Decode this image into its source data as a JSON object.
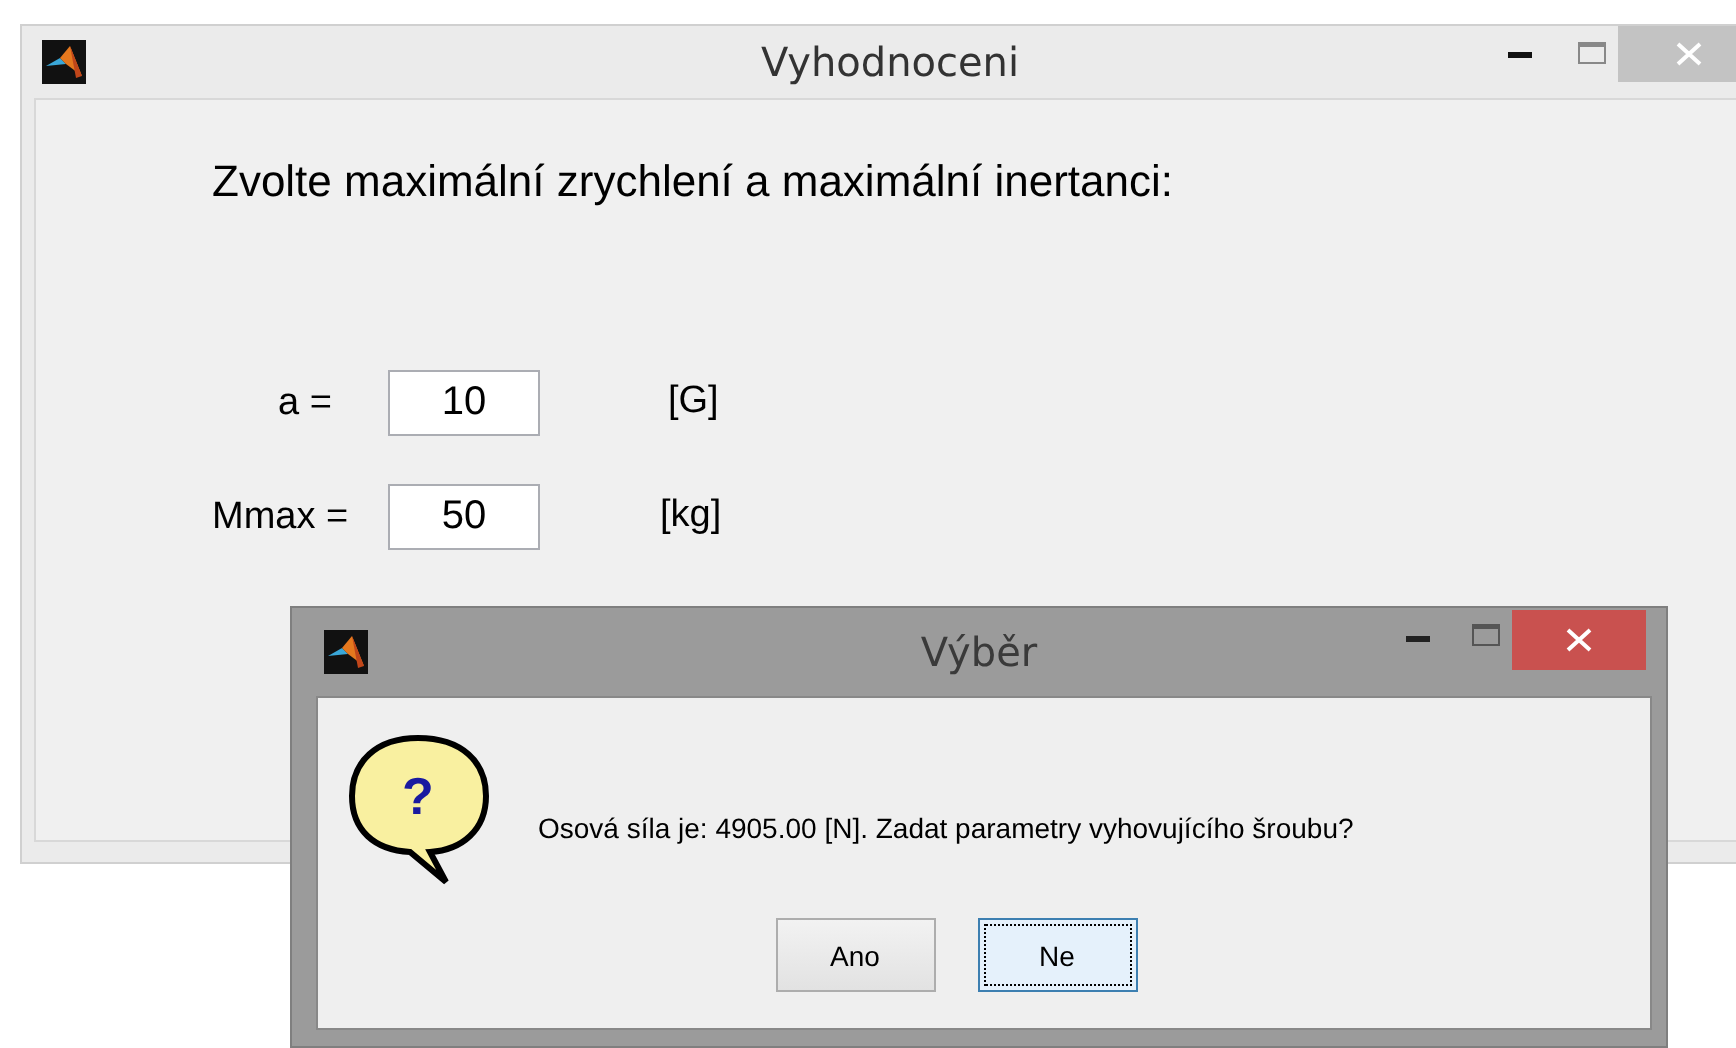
{
  "window": {
    "title": "Vyhodnoceni"
  },
  "prompt": "Zvolte maximální zrychlení a maximální inertanci:",
  "fields": [
    {
      "label": "a =",
      "value": "10",
      "unit": "[G]"
    },
    {
      "label": "Mmax =",
      "value": "50",
      "unit": "[kg]"
    }
  ],
  "dialog": {
    "title": "Výběr",
    "icon_mark": "?",
    "message": "Osová síla je: 4905.00 [N]. Zadat parametry vyhovujícího šroubu?",
    "buttons": [
      {
        "label": "Ano",
        "selected": false
      },
      {
        "label": "Ne",
        "selected": true
      }
    ]
  }
}
